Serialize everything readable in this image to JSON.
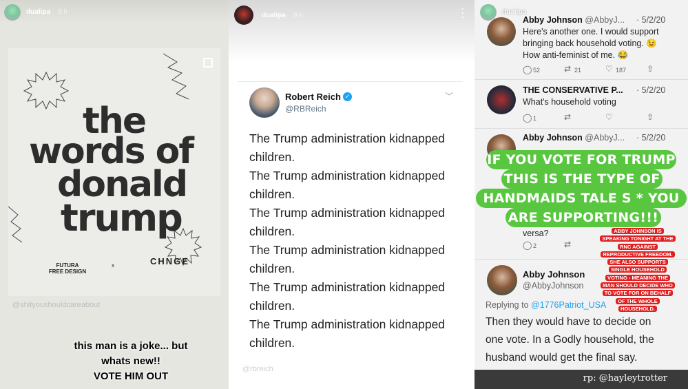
{
  "panel1": {
    "username": "dualipa",
    "time": "8 h",
    "title_lines": [
      "the",
      "words of",
      "donald",
      "trump"
    ],
    "logo_left": "FUTURA FREE DESIGN",
    "logo_x": "x",
    "logo_right": "CHNGE",
    "mention": "@shityoushouldcareabout",
    "caption_lines": [
      "this man is a joke... but",
      "whats new!!",
      "VOTE HIM OUT"
    ]
  },
  "panel2": {
    "username": "dualipa",
    "time": "8 h",
    "tweet": {
      "name": "Robert Reich",
      "handle": "@RBReich",
      "lines": [
        "The Trump administration kidnapped",
        "children.",
        "The Trump administration kidnapped",
        "children.",
        "The Trump administration kidnapped",
        "children.",
        "The Trump administration kidnapped",
        "children.",
        "The Trump administration kidnapped",
        "children.",
        "The Trump administration kidnapped",
        "children."
      ]
    },
    "mention": "@rbreich"
  },
  "panel3": {
    "username": "dualipa",
    "tweets": [
      {
        "name": "Abby Johnson",
        "handle": "@AbbyJ...",
        "date": "· 5/2/20",
        "body": [
          "Here's another one. I would support",
          "bringing back household voting. 😉",
          "How anti-feminist of me. 😂"
        ],
        "replies": "52",
        "retweets": "21",
        "likes": "187"
      },
      {
        "name": "THE CONSERVATIVE P...",
        "handle": "",
        "date": "· 5/2/20",
        "body": [
          "What's household voting"
        ],
        "replies": "1",
        "retweets": "",
        "likes": ""
      },
      {
        "name": "Abby Johnson",
        "handle": "@AbbyJ...",
        "date": "· 5/2/20",
        "body": [],
        "replies": "2",
        "retweets": "",
        "likes": ""
      }
    ],
    "partial_text": "versa?",
    "overlay_lines": [
      "IF YOU VOTE FOR TRUMP",
      "THIS IS THE TYPE OF",
      "HANDMAIDS TALE S  *  YOU",
      "ARE SUPPORTING!!!"
    ],
    "red_lines": [
      "ABBY JOHNSON IS",
      "SPEAKING TONIGHT AT THE",
      "RNC AGAINST",
      "REPRODUCTIVE FREEDOM.",
      "SHE ALSO SUPPORTS",
      "SINGLE HOUSEHOLD",
      "VOTING - MEANING THE",
      "MAN SHOULD DECIDE WHO",
      "TO VOTE FOR ON BEHALF",
      "OF THE WHOLE",
      "HOUSEHOLD."
    ],
    "big_tweet": {
      "name": "Abby Johnson",
      "handle": "@AbbyJohnson",
      "replying_prefix": "Replying to ",
      "replying_handle": "@1776Patriot_USA",
      "lines": [
        "Then they would have to decide on",
        "one vote. In a Godly household, the",
        "husband would get the final say."
      ]
    },
    "credit": "rp: @hayleytrotter"
  }
}
